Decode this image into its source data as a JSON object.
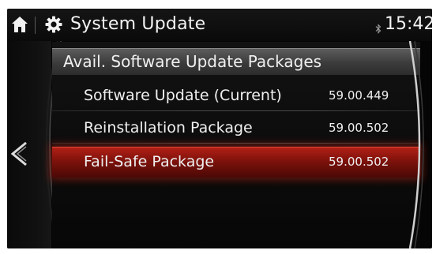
{
  "header": {
    "title": "System Update",
    "clock": "15:42",
    "icons": [
      "home-icon",
      "gear-icon",
      "bluetooth-icon"
    ]
  },
  "navigation": {
    "back_icon": "chevron-left-icon"
  },
  "list": {
    "section_title": "Avail. Software Update Packages",
    "rows": [
      {
        "label": "Software Update (Current)",
        "version": "59.00.449",
        "selected": false
      },
      {
        "label": "Reinstallation Package",
        "version": "59.00.502",
        "selected": false
      },
      {
        "label": "Fail-Safe Package",
        "version": "59.00.502",
        "selected": true
      }
    ]
  },
  "colors": {
    "selection": "#a01c12",
    "header_bg": "#0f0f0f",
    "text": "#f2f2f2"
  }
}
